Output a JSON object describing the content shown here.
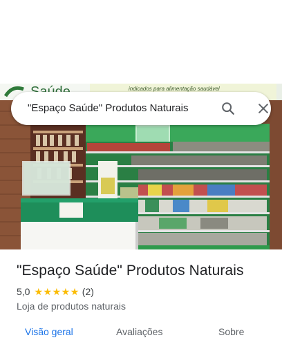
{
  "search": {
    "query": "\"Espaço Saúde\" Produtos Naturais",
    "search_icon": "search-icon",
    "close_icon": "close-icon"
  },
  "photo": {
    "sign_text": "Saúde",
    "banner_text": "indicados para alimentação saudável"
  },
  "place": {
    "title": "\"Espaço Saúde\" Produtos Naturais",
    "rating": "5,0",
    "stars": 5,
    "review_count": "(2)",
    "category": "Loja de produtos naturais"
  },
  "tabs": [
    {
      "label": "Visão geral",
      "active": true
    },
    {
      "label": "Avaliações",
      "active": false
    },
    {
      "label": "Sobre",
      "active": false
    }
  ],
  "colors": {
    "accent": "#1a73e8",
    "star": "#fbbc04",
    "text_primary": "#202124",
    "text_secondary": "#5f6368"
  }
}
